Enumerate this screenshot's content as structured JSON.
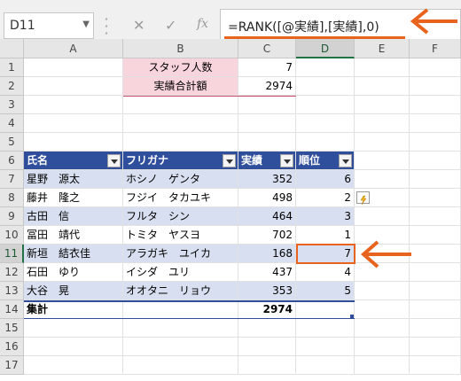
{
  "formula_bar": {
    "name_box": "D11",
    "cancel_icon": "close-icon",
    "enter_icon": "check-icon",
    "fx_label": "fx",
    "formula": "=RANK([@実績],[実績],0)"
  },
  "columns": [
    "A",
    "B",
    "C",
    "D",
    "E",
    "F"
  ],
  "selected_column": "D",
  "rows": [
    "1",
    "2",
    "3",
    "4",
    "5",
    "6",
    "7",
    "8",
    "9",
    "10",
    "11",
    "12",
    "13",
    "14",
    "15",
    "16",
    "17"
  ],
  "selected_row": "11",
  "summary": {
    "staff_label": "スタッフ人数",
    "staff_value": "7",
    "total_label": "実績合計額",
    "total_value": "2974"
  },
  "table": {
    "headers": [
      "氏名",
      "フリガナ",
      "実績",
      "順位"
    ],
    "rows": [
      [
        "星野　源太",
        "ホシノ　ゲンタ",
        "352",
        "6"
      ],
      [
        "藤井　隆之",
        "フジイ　タカユキ",
        "498",
        "2"
      ],
      [
        "古田　信",
        "フルタ　シン",
        "464",
        "3"
      ],
      [
        "冨田　靖代",
        "トミタ　ヤスヨ",
        "702",
        "1"
      ],
      [
        "新垣　結衣佳",
        "アラガキ　ユイカ",
        "168",
        "7"
      ],
      [
        "石田　ゆり",
        "イシダ　ユリ",
        "437",
        "4"
      ],
      [
        "大谷　晃",
        "オオタニ　リョウ",
        "353",
        "5"
      ]
    ],
    "total_label": "集計",
    "total_value": "2974"
  },
  "colors": {
    "accent": "#e8641e",
    "table_header": "#2f4f9c",
    "band": "#d8dff0",
    "pink": "#f8d4dc"
  }
}
